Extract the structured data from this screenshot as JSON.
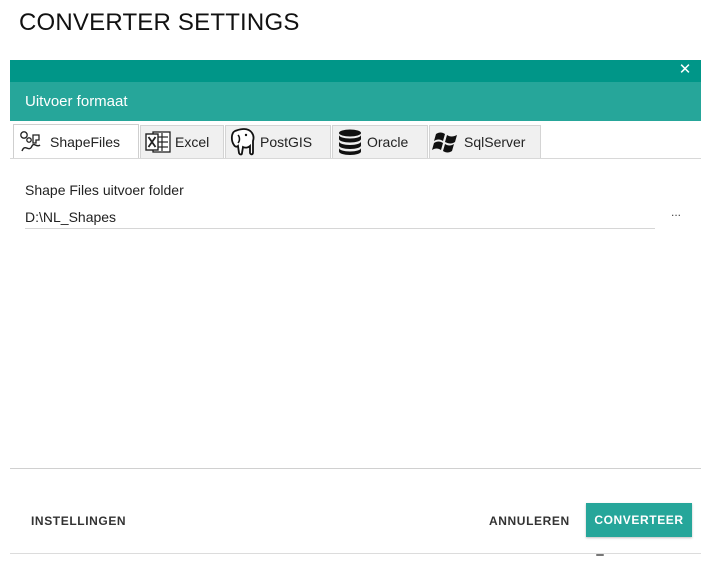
{
  "page": {
    "title": "CONVERTER SETTINGS"
  },
  "dialog": {
    "header_title": "Uitvoer formaat",
    "close_glyph": "✕",
    "colors": {
      "topbar": "#009688",
      "header": "#26a69a",
      "primary_button": "#26a69a"
    },
    "tabs": [
      {
        "label": "ShapeFiles",
        "icon": "shapes-icon",
        "active": true
      },
      {
        "label": "Excel",
        "icon": "excel-icon",
        "active": false
      },
      {
        "label": "PostGIS",
        "icon": "elephant-icon",
        "active": false
      },
      {
        "label": "Oracle",
        "icon": "database-icon",
        "active": false
      },
      {
        "label": "SqlServer",
        "icon": "windows-icon",
        "active": false
      }
    ],
    "output_folder": {
      "label": "Shape Files uitvoer folder",
      "value": "D:\\NL_Shapes",
      "browse_label": "..."
    },
    "footer": {
      "settings_label": "INSTELLINGEN",
      "cancel_label": "ANNULEREN",
      "convert_label": "CONVERTEER"
    }
  }
}
